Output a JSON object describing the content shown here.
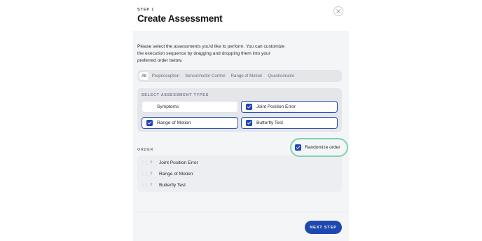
{
  "header": {
    "step_label": "STEP 1",
    "title": "Create Assessment"
  },
  "description": "Please select the assessments you'd like to perform. You can customize the execution sequence by dragging and dropping them into your preferred order below.",
  "tabs": [
    {
      "label": "All",
      "active": true
    },
    {
      "label": "Proprioception",
      "active": false
    },
    {
      "label": "Sensorimotor Control",
      "active": false
    },
    {
      "label": "Range of Motion",
      "active": false
    },
    {
      "label": "Questionnaire",
      "active": false
    }
  ],
  "assessment_types": {
    "section_label": "SELECT ASSESSMENT TYPES",
    "options": [
      {
        "label": "Symptoms",
        "checked": false
      },
      {
        "label": "Joint Position Error",
        "checked": true
      },
      {
        "label": "Range of Motion",
        "checked": true
      },
      {
        "label": "Butterfly Test",
        "checked": true
      }
    ]
  },
  "order": {
    "section_label": "ORDER",
    "randomize_label": "Randomize order",
    "randomize_checked": true,
    "items": [
      {
        "label": "Joint Position Error",
        "icon": "?"
      },
      {
        "label": "Range of Motion",
        "icon": "?"
      },
      {
        "label": "Butterfly Test",
        "icon": "?"
      }
    ]
  },
  "footer": {
    "next_label": "NEXT STEP"
  },
  "colors": {
    "primary": "#1f47b0",
    "highlight_ring": "#7fd2b0",
    "panel_background": "#f4f5f7"
  }
}
